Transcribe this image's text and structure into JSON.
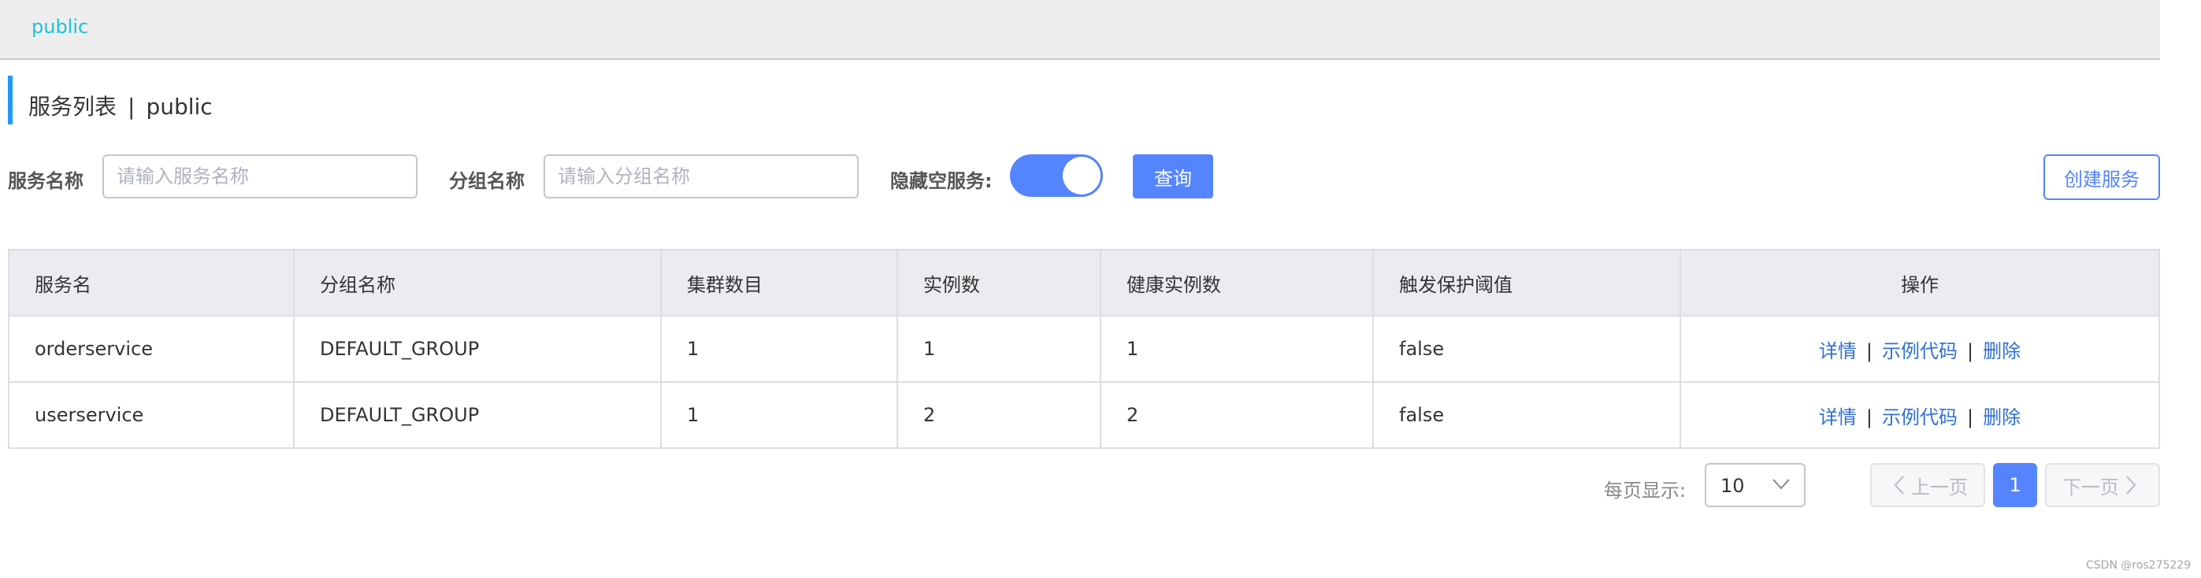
{
  "namespace_bar": {
    "active": "public"
  },
  "title": {
    "main": "服务列表",
    "separator": "|",
    "namespace": "public"
  },
  "filters": {
    "service_name_label": "服务名称",
    "service_name_placeholder": "请输入服务名称",
    "group_name_label": "分组名称",
    "group_name_placeholder": "请输入分组名称",
    "hide_empty_label": "隐藏空服务:",
    "hide_empty_on": true,
    "query_button": "查询",
    "create_button": "创建服务"
  },
  "table": {
    "headers": [
      "服务名",
      "分组名称",
      "集群数目",
      "实例数",
      "健康实例数",
      "触发保护阈值",
      "操作"
    ],
    "rows": [
      {
        "service": "orderservice",
        "group": "DEFAULT_GROUP",
        "clusters": "1",
        "instances": "1",
        "healthy": "1",
        "threshold": "false"
      },
      {
        "service": "userservice",
        "group": "DEFAULT_GROUP",
        "clusters": "1",
        "instances": "2",
        "healthy": "2",
        "threshold": "false"
      }
    ],
    "actions": {
      "detail": "详情",
      "sample_code": "示例代码",
      "delete": "删除",
      "separator": "|"
    }
  },
  "pagination": {
    "page_size_label": "每页显示:",
    "page_size": "10",
    "prev": "上一页",
    "current_page": "1",
    "next": "下一页"
  },
  "watermark": "CSDN @ros275229",
  "colors": {
    "primary": "#5584ff",
    "accent_bar": "#209bfa",
    "namespace_link": "#1cc3d6",
    "action_link": "#2e6fd6"
  },
  "icons": {
    "select": "chevron-down-icon",
    "prev": "chevron-left-icon",
    "next": "chevron-right-icon"
  }
}
